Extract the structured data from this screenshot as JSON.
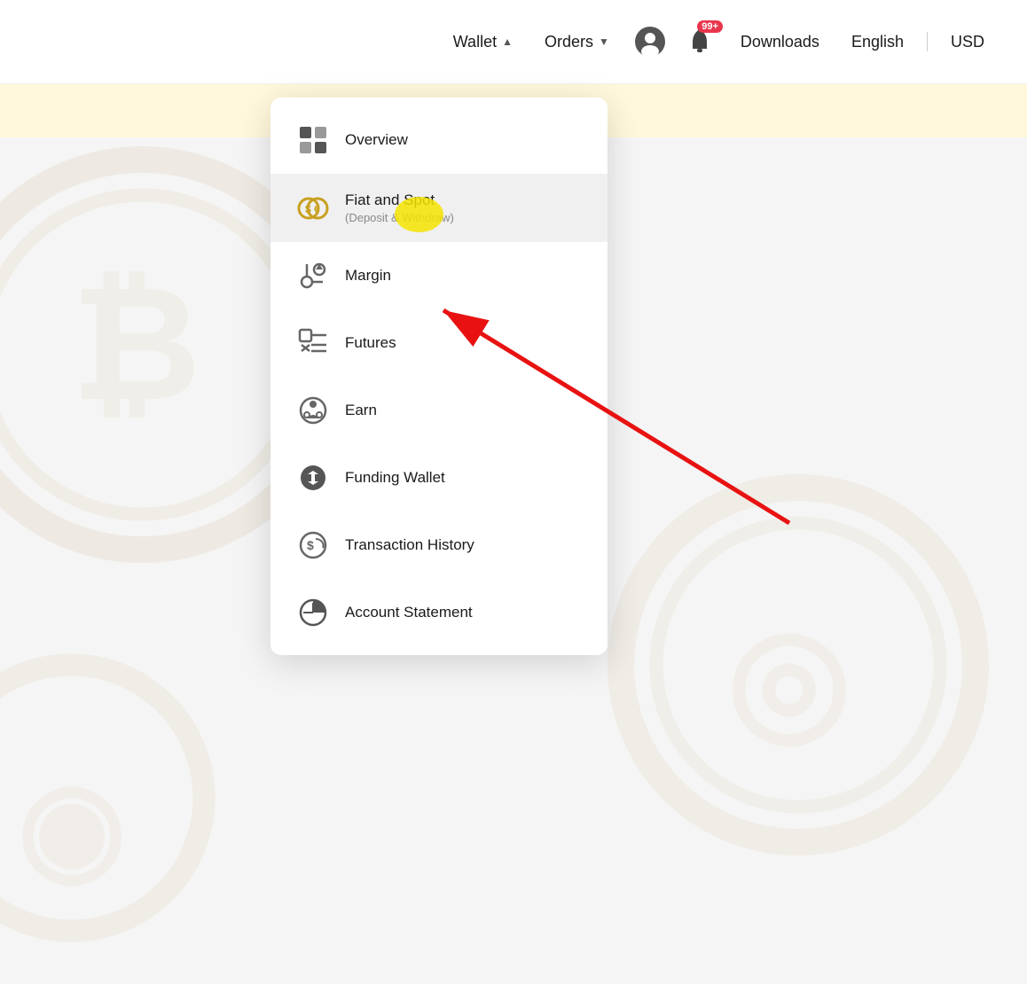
{
  "navbar": {
    "wallet_label": "Wallet",
    "orders_label": "Orders",
    "downloads_label": "Downloads",
    "english_label": "English",
    "usd_label": "USD",
    "notification_badge": "99+"
  },
  "dropdown": {
    "items": [
      {
        "id": "overview",
        "title": "Overview",
        "subtitle": "",
        "icon": "overview-icon"
      },
      {
        "id": "fiat-spot",
        "title": "Fiat and Spot",
        "subtitle": "(Deposit & Withdraw)",
        "icon": "fiat-spot-icon",
        "highlighted": true
      },
      {
        "id": "margin",
        "title": "Margin",
        "subtitle": "",
        "icon": "margin-icon"
      },
      {
        "id": "futures",
        "title": "Futures",
        "subtitle": "",
        "icon": "futures-icon"
      },
      {
        "id": "earn",
        "title": "Earn",
        "subtitle": "",
        "icon": "earn-icon"
      },
      {
        "id": "funding-wallet",
        "title": "Funding Wallet",
        "subtitle": "",
        "icon": "funding-wallet-icon"
      },
      {
        "id": "transaction-history",
        "title": "Transaction History",
        "subtitle": "",
        "icon": "transaction-history-icon"
      },
      {
        "id": "account-statement",
        "title": "Account Statement",
        "subtitle": "",
        "icon": "account-statement-icon"
      }
    ]
  }
}
